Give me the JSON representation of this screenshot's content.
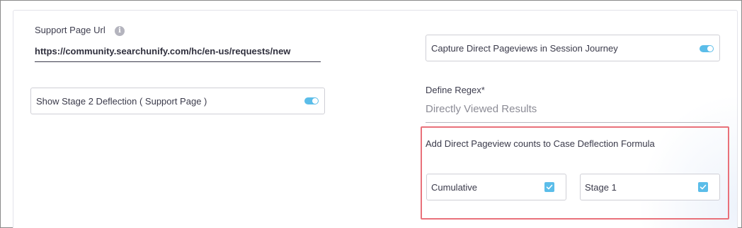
{
  "support_page": {
    "label": "Support Page Url",
    "info_icon": "info-icon",
    "url_value": "https://community.searchunify.com/hc/en-us/requests/new"
  },
  "stage2_toggle": {
    "label": "Show Stage 2 Deflection ( Support Page )",
    "enabled": true
  },
  "capture_toggle": {
    "label": "Capture Direct Pageviews in Session Journey",
    "enabled": true
  },
  "regex": {
    "label": "Define Regex*",
    "placeholder": "Directly Viewed Results"
  },
  "formula": {
    "title": "Add Direct Pageview counts to Case Deflection Formula",
    "options": [
      {
        "label": "Cumulative",
        "checked": true
      },
      {
        "label": "Stage 1",
        "checked": true
      }
    ]
  },
  "colors": {
    "accent": "#5bbde9",
    "highlight_border": "#e9717a"
  }
}
